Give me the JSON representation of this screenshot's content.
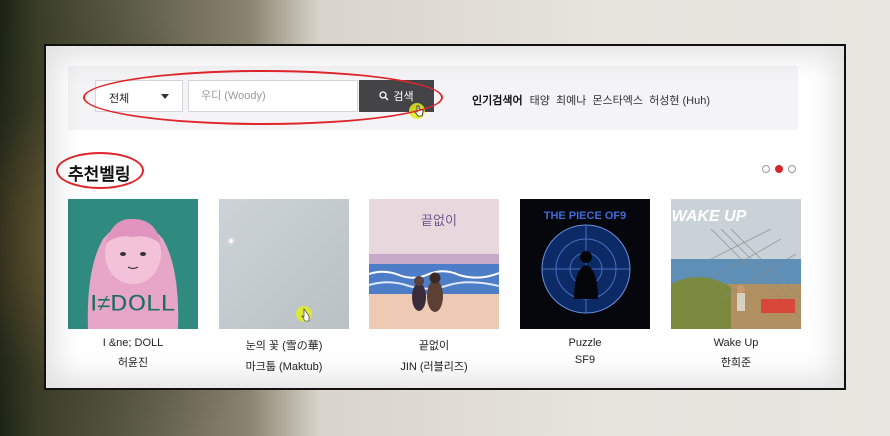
{
  "search": {
    "category_selected": "전체",
    "input_value": "",
    "placeholder": "우디 (Woody)",
    "button_label": "검색"
  },
  "popular": {
    "label": "인기검색어",
    "keywords": [
      "태양",
      "최예나",
      "몬스타엑스",
      "허성현 (Huh)"
    ]
  },
  "recommend": {
    "title": "추천벨링",
    "page_count": 3,
    "active_page": 2,
    "albums": [
      {
        "title": "I  &ne; DOLL",
        "artist": "허윤진",
        "cover_icon": "pink-girl-illustration",
        "cover_text": "I≠DOLL"
      },
      {
        "title": "눈의 꽃 (雪の華)",
        "artist": "마크툽 (Maktub)",
        "cover_icon": "snow-light-blue-cover",
        "cover_text": ""
      },
      {
        "title": "끝없이",
        "artist": "JIN (러블리즈)",
        "cover_icon": "couple-beach-illustration",
        "cover_text": "끝없이"
      },
      {
        "title": "Puzzle",
        "artist": "SF9",
        "cover_icon": "target-silhouette-cover",
        "cover_text": "THE PIECE OF9"
      },
      {
        "title": "Wake Up",
        "artist": "한희준",
        "cover_icon": "fence-landscape-cover",
        "cover_text": "WAKE UP"
      }
    ]
  },
  "colors": {
    "accent_red": "#d6272b",
    "search_button": "#444446",
    "annotation_red": "#e0262a"
  }
}
